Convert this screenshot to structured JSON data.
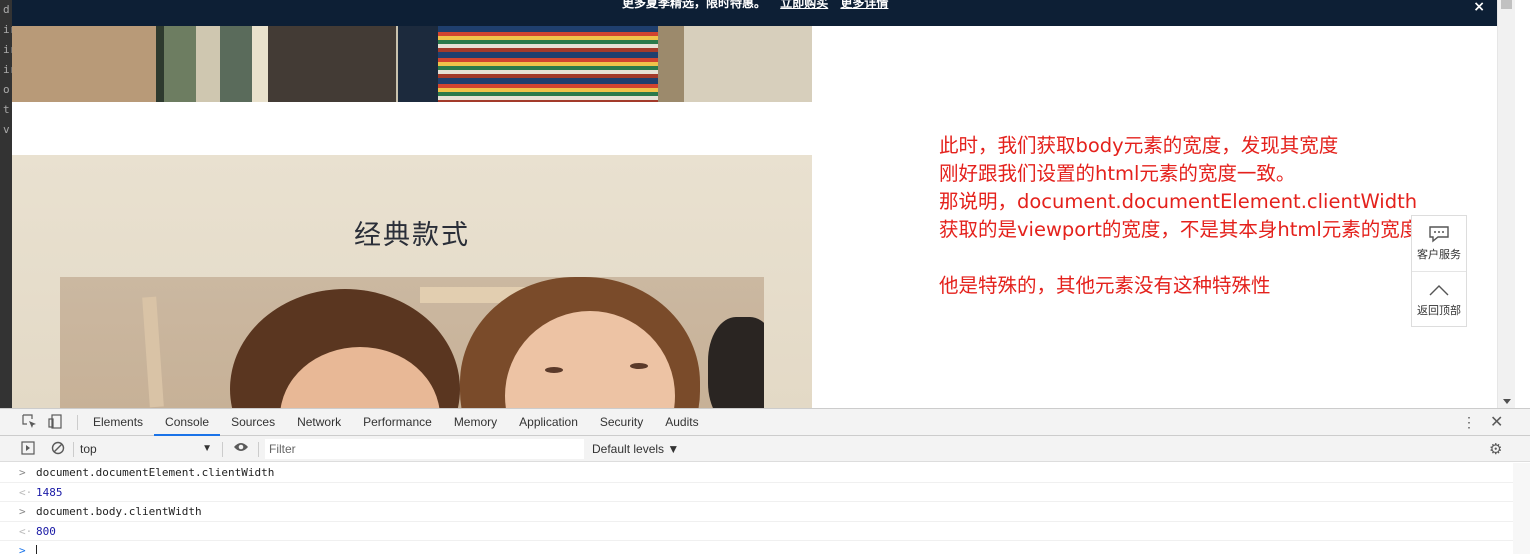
{
  "gutter": {
    "letters": [
      "d",
      "ir",
      "ir",
      "ir",
      "o",
      "t",
      "v"
    ]
  },
  "promo": {
    "text": "更多夏季精选，限时特惠。",
    "buy_link": "立即购买",
    "details_link": "更多详情",
    "close_label": "×"
  },
  "section": {
    "title": "经典款式"
  },
  "annotation": {
    "lines": [
      "此时，我们获取body元素的宽度，发现其宽度",
      "刚好跟我们设置的html元素的宽度一致。",
      "那说明，document.documentElement.clientWidth",
      "获取的是viewport的宽度，不是其本身html元素的宽度",
      "他是特殊的，其他元素没有这种特殊性"
    ]
  },
  "float_widget": {
    "service_label": "客户服务",
    "top_label": "返回顶部"
  },
  "devtools": {
    "tabs": [
      "Elements",
      "Console",
      "Sources",
      "Network",
      "Performance",
      "Memory",
      "Application",
      "Security",
      "Audits"
    ],
    "active_tab": "Console",
    "context": "top",
    "filter_placeholder": "Filter",
    "levels": "Default levels ▼",
    "console": [
      {
        "kind": "input",
        "text": "document.documentElement.clientWidth"
      },
      {
        "kind": "result",
        "text": "1485"
      },
      {
        "kind": "input",
        "text": "document.body.clientWidth"
      },
      {
        "kind": "result",
        "text": "800"
      }
    ]
  }
}
